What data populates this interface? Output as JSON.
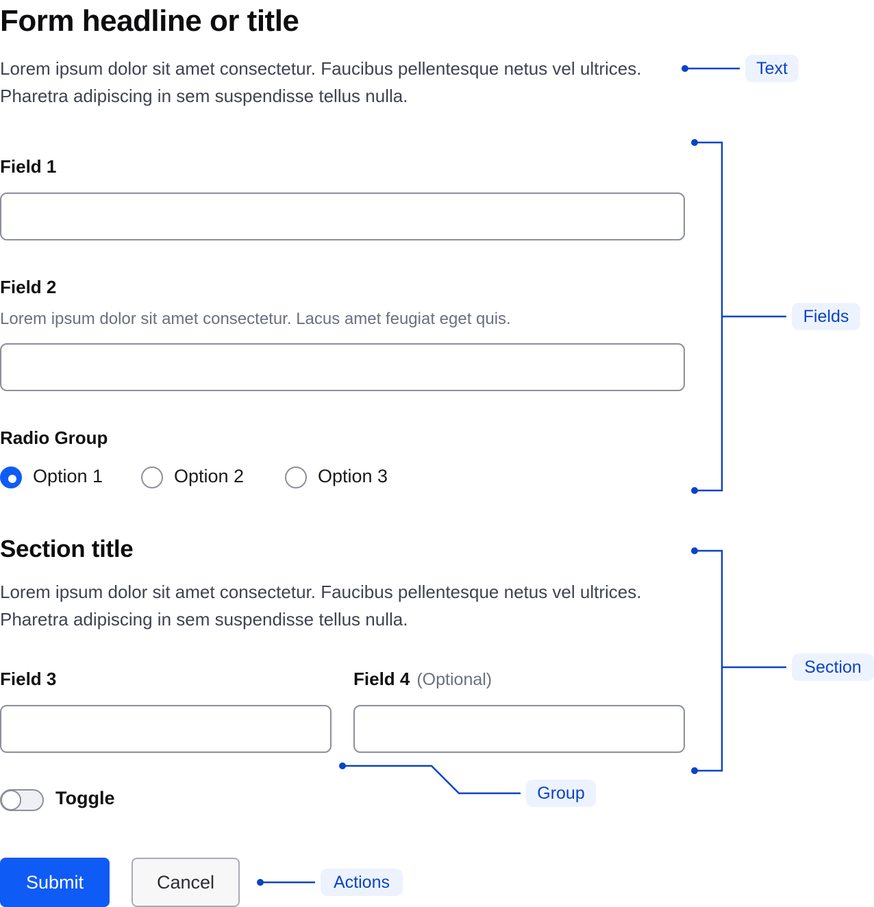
{
  "form": {
    "title": "Form headline or title",
    "description": "Lorem ipsum dolor sit amet consectetur. Faucibus pellentesque netus vel ultrices. Pharetra adipiscing in sem suspendisse tellus nulla.",
    "fields": [
      {
        "label": "Field 1",
        "value": "",
        "placeholder": ""
      },
      {
        "label": "Field 2",
        "helper": "Lorem ipsum dolor sit amet consectetur. Lacus amet feugiat eget quis.",
        "value": "",
        "placeholder": ""
      }
    ],
    "radio_group": {
      "label": "Radio Group",
      "options": [
        {
          "label": "Option 1",
          "checked": true
        },
        {
          "label": "Option 2",
          "checked": false
        },
        {
          "label": "Option 3",
          "checked": false
        }
      ]
    },
    "section": {
      "title": "Section title",
      "description": "Lorem ipsum dolor sit amet consectetur. Faucibus pellentesque netus vel ultrices. Pharetra adipiscing in sem suspendisse tellus nulla.",
      "fields": [
        {
          "label": "Field 3",
          "value": ""
        },
        {
          "label": "Field 4",
          "optional_label": "(Optional)",
          "value": ""
        }
      ]
    },
    "toggle": {
      "label": "Toggle",
      "on": false
    },
    "actions": {
      "submit_label": "Submit",
      "cancel_label": "Cancel"
    }
  },
  "annotations": {
    "color": "#0b43c8",
    "tag_background": "#edf3fe",
    "items": [
      "Text",
      "Fields",
      "Section",
      "Group",
      "Actions"
    ]
  },
  "colors": {
    "primary": "#0f5bf5",
    "text": "#111111",
    "muted": "#6b7080",
    "input_border": "#8c8f9c"
  }
}
